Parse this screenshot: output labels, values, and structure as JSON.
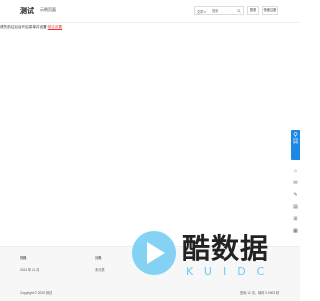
{
  "header": {
    "site_title": "测试",
    "nav_home": "示例页面",
    "search": {
      "type_label": "文章 ▾",
      "placeholder": "搜索"
    },
    "login_label": "登录",
    "register_label": "快速注册"
  },
  "notice": {
    "text": "请先前往后台开启菜单并设置:",
    "link": "前往设置"
  },
  "footer": {
    "col1_title": "归档",
    "col1_item": "2024 年 11 月",
    "col2_title": "分类",
    "col2_item": "未分类",
    "copyright": "Copyright © 2025 测试",
    "stats": "查询 12 次，耗时 0.0903 秒"
  },
  "sidebar": {
    "badge_icon": "location-icon",
    "badge_lines": [
      "在线",
      "客服"
    ],
    "icons": [
      "gift-icon",
      "chat-icon",
      "edit-icon",
      "document-icon",
      "shopping-icon",
      "calendar-icon",
      "search-icon",
      "grid-icon",
      "arrow-up-icon"
    ]
  },
  "watermark": {
    "title": "酷数据",
    "subtitle": "KUIDC"
  },
  "colors": {
    "accent": "#1e88e5",
    "link_red": "#e53935",
    "watermark_blue": "#6ecbf2"
  }
}
